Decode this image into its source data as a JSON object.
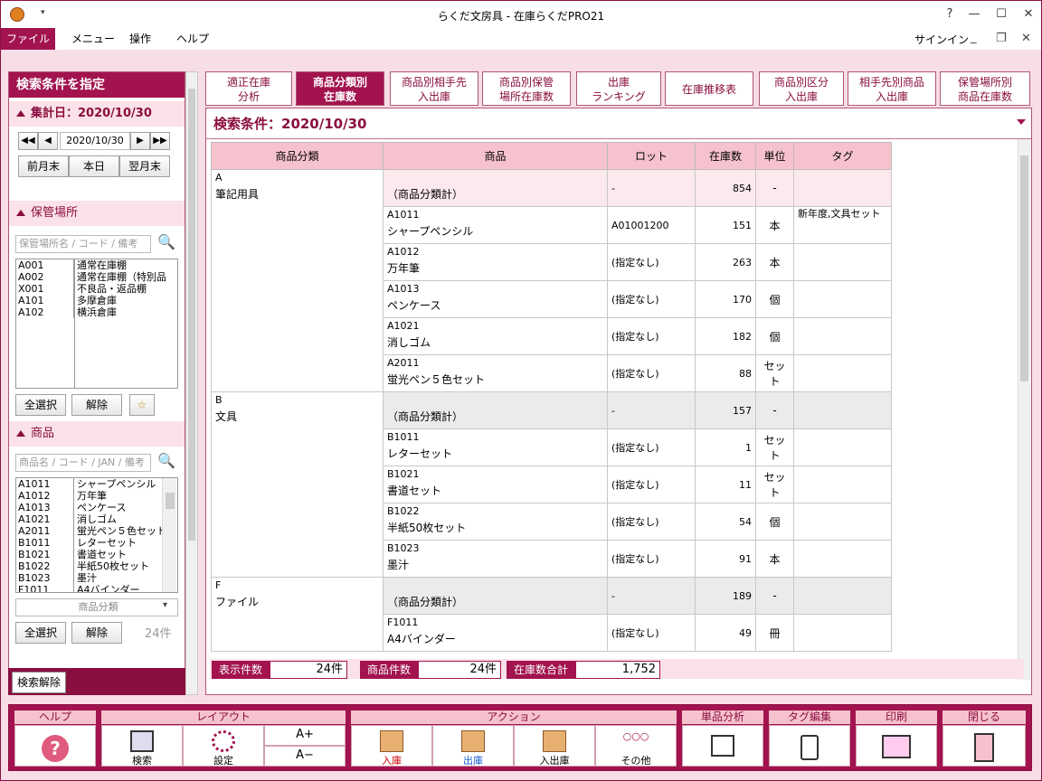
{
  "window": {
    "title": "らくだ文房具 - 在庫らくだPRO21",
    "help": "?",
    "minimize": "—",
    "maximize": "☐",
    "close": "✕"
  },
  "menu": {
    "file": "ファイル",
    "menu": "メニュー",
    "ops": "操作",
    "help": "ヘルプ",
    "signin": "サインイン"
  },
  "left": {
    "title": "検索条件を指定",
    "date_section": "集計日：2020/10/30",
    "date_value": "2020/10/30",
    "prev_month_end": "前月末",
    "today": "本日",
    "next_month_end": "翌月末",
    "storage_section": "保管場所",
    "storage_placeholder": "保管場所名 / コード / 備考",
    "storage_list": [
      {
        "code": "A001",
        "name": "通常在庫棚"
      },
      {
        "code": "A002",
        "name": "通常在庫棚（特別品"
      },
      {
        "code": "X001",
        "name": "不良品・返品棚"
      },
      {
        "code": "A101",
        "name": "多摩倉庫"
      },
      {
        "code": "A102",
        "name": "横浜倉庫"
      }
    ],
    "select_all": "全選択",
    "clear": "解除",
    "star": "☆",
    "product_section": "商品",
    "product_placeholder": "商品名 / コード / JAN / 備考",
    "product_list": [
      {
        "code": "A1011",
        "name": "シャープペンシル"
      },
      {
        "code": "A1012",
        "name": "万年筆"
      },
      {
        "code": "A1013",
        "name": "ペンケース"
      },
      {
        "code": "A1021",
        "name": "消しゴム"
      },
      {
        "code": "A2011",
        "name": "蛍光ペン５色セット"
      },
      {
        "code": "B1011",
        "name": "レターセット"
      },
      {
        "code": "B1021",
        "name": "書道セット"
      },
      {
        "code": "B1022",
        "name": "半紙50枚セット"
      },
      {
        "code": "B1023",
        "name": "墨汁"
      },
      {
        "code": "F1011",
        "name": "A4バインダー"
      }
    ],
    "category_select": "商品分類",
    "select_all2": "全選択",
    "clear2": "解除",
    "count": "24件",
    "search_clear": "検索解除"
  },
  "tabs": [
    {
      "l1": "適正在庫",
      "l2": "分析"
    },
    {
      "l1": "商品分類別",
      "l2": "在庫数"
    },
    {
      "l1": "商品別相手先",
      "l2": "入出庫"
    },
    {
      "l1": "商品別保管",
      "l2": "場所在庫数"
    },
    {
      "l1": "出庫",
      "l2": "ランキング"
    },
    {
      "l1": "在庫推移表",
      "l2": ""
    },
    {
      "l1": "商品別区分",
      "l2": "入出庫"
    },
    {
      "l1": "相手先別商品",
      "l2": "入出庫"
    },
    {
      "l1": "保管場所別",
      "l2": "商品在庫数"
    }
  ],
  "criteria": "検索条件：2020/10/30",
  "table": {
    "headers": [
      "商品分類",
      "商品",
      "ロット",
      "在庫数",
      "単位",
      "タグ"
    ],
    "rows": [
      {
        "cat_code": "A",
        "cat_name": "筆記用具",
        "code": "",
        "name": "（商品分類計）",
        "lot": "-",
        "qty": "854",
        "unit": "-",
        "tag": "",
        "sum": true
      },
      {
        "code": "A1011",
        "name": "シャープペンシル",
        "lot": "A01001200",
        "qty": "151",
        "unit": "本",
        "tag": "新年度,文具セット"
      },
      {
        "code": "A1012",
        "name": "万年筆",
        "lot": "(指定なし)",
        "qty": "263",
        "unit": "本",
        "tag": ""
      },
      {
        "code": "A1013",
        "name": "ペンケース",
        "lot": "(指定なし)",
        "qty": "170",
        "unit": "個",
        "tag": ""
      },
      {
        "code": "A1021",
        "name": "消しゴム",
        "lot": "(指定なし)",
        "qty": "182",
        "unit": "個",
        "tag": ""
      },
      {
        "code": "A2011",
        "name": "蛍光ペン５色セット",
        "lot": "(指定なし)",
        "qty": "88",
        "unit": "セット",
        "tag": ""
      },
      {
        "cat_code": "B",
        "cat_name": "文具",
        "code": "",
        "name": "（商品分類計）",
        "lot": "-",
        "qty": "157",
        "unit": "-",
        "tag": "",
        "sum": true
      },
      {
        "code": "B1011",
        "name": "レターセット",
        "lot": "(指定なし)",
        "qty": "1",
        "unit": "セット",
        "tag": ""
      },
      {
        "code": "B1021",
        "name": "書道セット",
        "lot": "(指定なし)",
        "qty": "11",
        "unit": "セット",
        "tag": ""
      },
      {
        "code": "B1022",
        "name": "半紙50枚セット",
        "lot": "(指定なし)",
        "qty": "54",
        "unit": "個",
        "tag": ""
      },
      {
        "code": "B1023",
        "name": "墨汁",
        "lot": "(指定なし)",
        "qty": "91",
        "unit": "本",
        "tag": ""
      },
      {
        "cat_code": "F",
        "cat_name": "ファイル",
        "code": "",
        "name": "（商品分類計）",
        "lot": "-",
        "qty": "189",
        "unit": "-",
        "tag": "",
        "sum": true
      },
      {
        "code": "F1011",
        "name": "A4バインダー",
        "lot": "(指定なし)",
        "qty": "49",
        "unit": "冊",
        "tag": ""
      }
    ]
  },
  "status": {
    "shown_label": "表示件数",
    "shown_value": "24件",
    "items_label": "商品件数",
    "items_value": "24件",
    "total_label": "在庫数合計",
    "total_value": "1,752"
  },
  "toolbar": {
    "help_group": "ヘルプ",
    "layout_group": "レイアウト",
    "search": "検索",
    "settings": "設定",
    "font_up": "A+",
    "font_down": "A−",
    "action_group": "アクション",
    "in": "入庫",
    "out": "出庫",
    "inout": "入出庫",
    "dots": "○○○",
    "other": "その他",
    "single_group": "単品分析",
    "tag_group": "タグ編集",
    "print_group": "印刷",
    "close_group": "閉じる"
  }
}
